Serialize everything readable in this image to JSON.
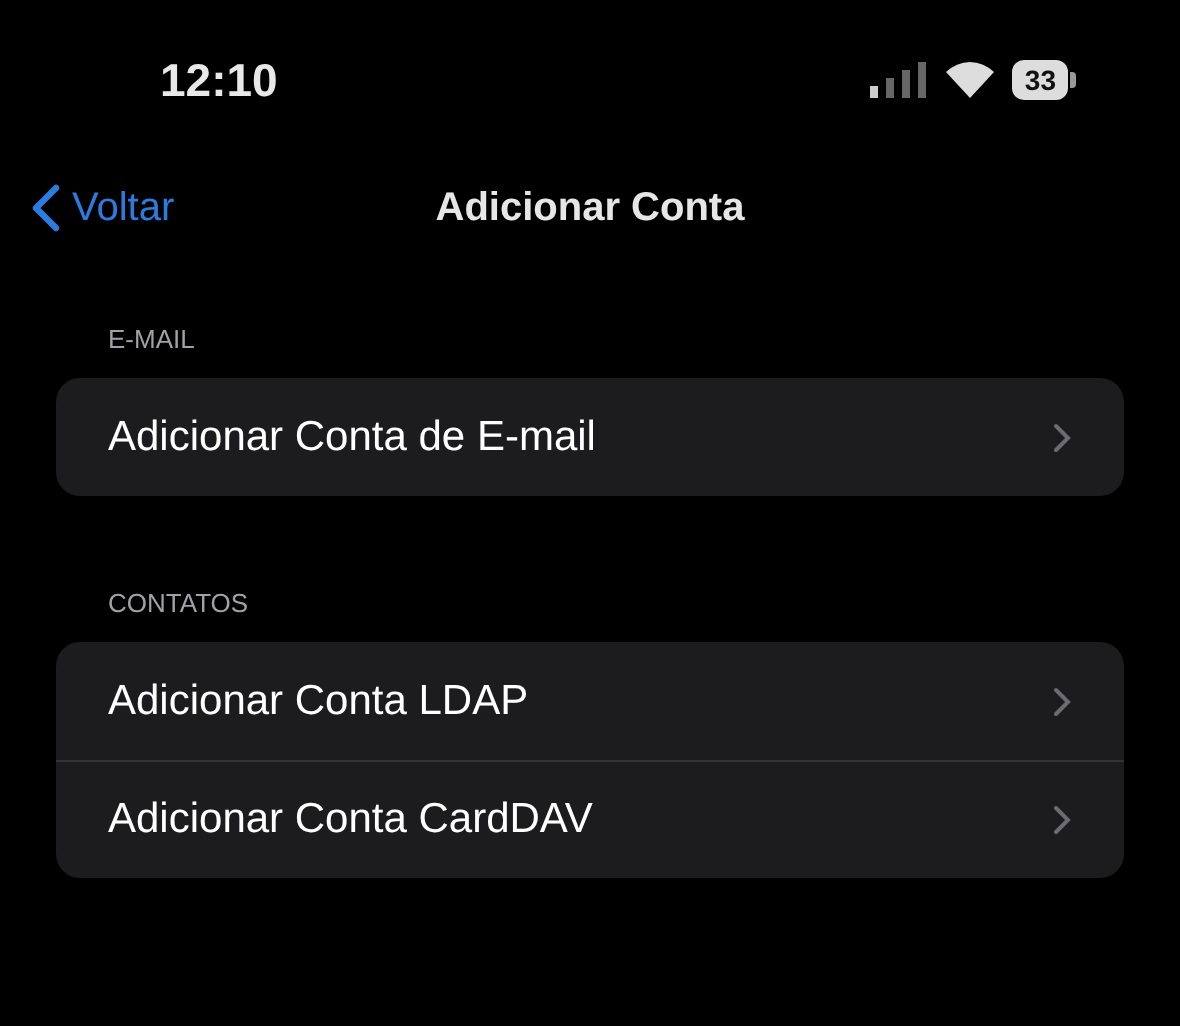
{
  "status_bar": {
    "time": "12:10",
    "battery": "33"
  },
  "nav": {
    "back": "Voltar",
    "title": "Adicionar Conta"
  },
  "sections": [
    {
      "header": "E-MAIL",
      "rows": [
        {
          "label": "Adicionar Conta de E-mail"
        }
      ]
    },
    {
      "header": "CONTATOS",
      "rows": [
        {
          "label": "Adicionar Conta LDAP"
        },
        {
          "label": "Adicionar Conta CardDAV"
        }
      ]
    }
  ]
}
